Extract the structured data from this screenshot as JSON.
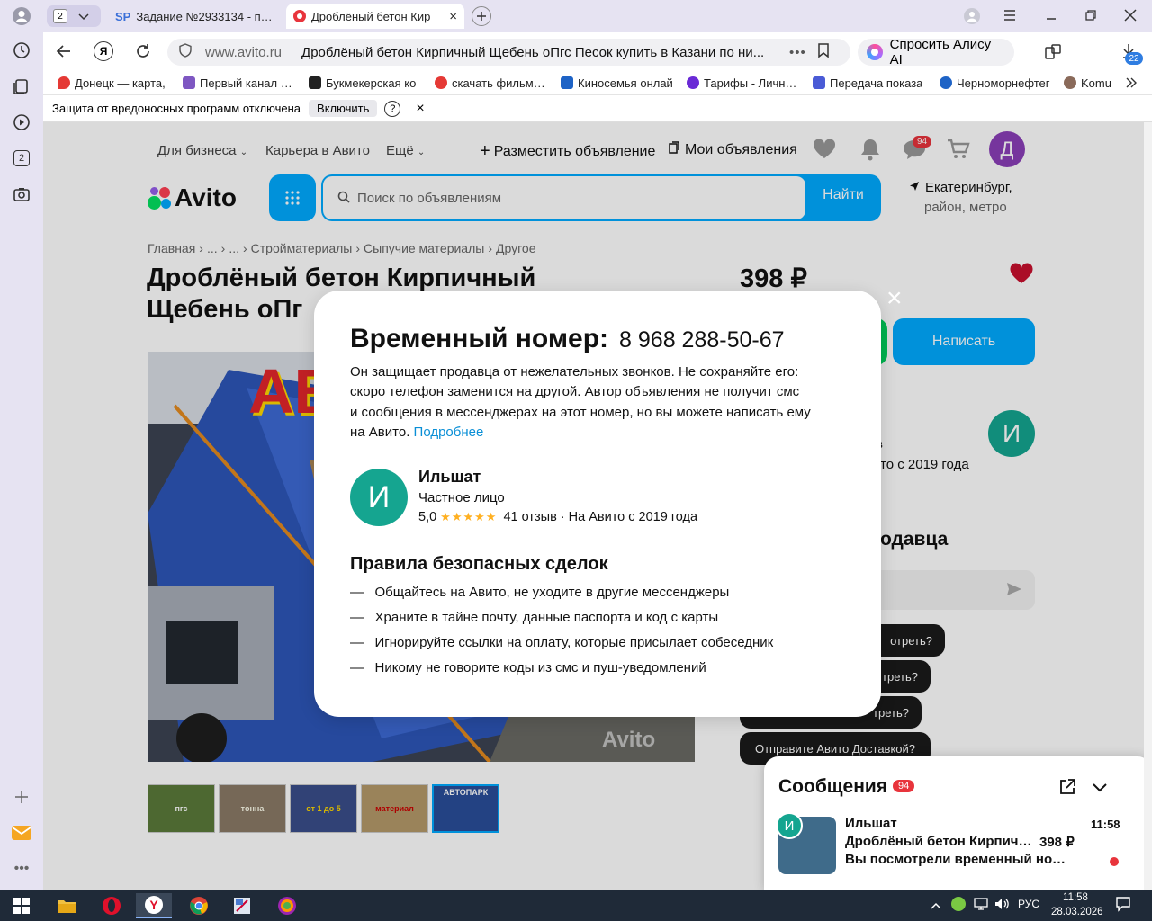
{
  "browser": {
    "tab_counter": "2",
    "tabs": [
      {
        "label": "Задание №2933134 - про",
        "favicon_text": "SP"
      },
      {
        "label": "Дроблёный бетон Кир",
        "active": true
      }
    ],
    "address": {
      "domain": "www.avito.ru",
      "title": "Дроблёный бетон Кирпичный Щебень оПгс Песок купить в Казани по ни..."
    },
    "alice_label": "Спросить Алису AI",
    "downloads_badge": "22",
    "bookmarks": [
      {
        "label": "Донецк — карта, ",
        "color": "#e53935"
      },
      {
        "label": "Первый канал — c",
        "color": "#7e57c2"
      },
      {
        "label": "Букмекерская ко",
        "color": "#222222"
      },
      {
        "label": "скачать фильмы 2",
        "color": "#e53935"
      },
      {
        "label": "Киносемья онлай",
        "color": "#1e63c6"
      },
      {
        "label": "Тарифы - Личный",
        "color": "#6a2ad6"
      },
      {
        "label": "Передача показа",
        "color": "#4a5bd6"
      },
      {
        "label": "Черноморнефтег",
        "color": "#1e63c6"
      },
      {
        "label": "Komu",
        "color": "#8a6a5a"
      }
    ],
    "infobar": {
      "text": "Защита от вредоносных программ отключена",
      "button": "Включить",
      "help": "?",
      "close": "×"
    }
  },
  "avito": {
    "nav": {
      "for_business": "Для бизнеса",
      "career": "Карьера в Авито",
      "more": "Ещё",
      "post_ad": "Разместить объявление",
      "my_ads": "Мои объявления",
      "messages_badge": "94",
      "avatar_letter": "Д"
    },
    "logo_text": "Avito",
    "search": {
      "placeholder": "Поиск по объявлениям",
      "button": "Найти"
    },
    "location": {
      "city": "Екатеринбург,",
      "sub": "район, метро"
    },
    "breadcrumbs": [
      "Главная",
      "...",
      "...",
      "Стройматериалы",
      "Сыпучие материалы",
      "Другое"
    ],
    "title_line1": "Дроблёный бетон Кирпичный",
    "title_line2": "Щебень оПг",
    "price": "398 ₽",
    "write_button": "Написать",
    "seller_since_partial": "то с 2019 года",
    "seller_partial_char": "в",
    "ask_heading_partial": "одавца",
    "quick_questions": [
      "отреть?",
      "треть?",
      "треть?",
      "Отправите Авито Доставкой?"
    ],
    "watermark": "Avito",
    "photo_banner": "АВ",
    "thumbnails": [
      {
        "label": "пгс",
        "color": "#5b7a3a"
      },
      {
        "label": "тонна",
        "color": "#8a7a66"
      },
      {
        "label": "от 1 до 5",
        "color": "#3a4e8a"
      },
      {
        "label": "материал",
        "color": "#b59a6a"
      },
      {
        "label": "АВТОПАРК",
        "color": "#2a4e9a"
      }
    ]
  },
  "modal": {
    "heading": "Временный номер:",
    "phone": "8 968 288-50-67",
    "description_lines": [
      "Он защищает продавца от нежелательных звонков. Не сохраняйте его:",
      "скоро телефон заменится на другой. Автор объявления не получит смс",
      "и сообщения в мессенджерах на этот номер, но вы можете написать ему"
    ],
    "description_last": "на Авито.",
    "more_link": "Подробнее",
    "seller": {
      "avatar_letter": "И",
      "name": "Ильшат",
      "type": "Частное лицо",
      "rating": "5,0",
      "stars": "★★★★★",
      "reviews": "41 отзыв · На Авито с 2019 года"
    },
    "rules_title": "Правила безопасных сделок",
    "rules": [
      "Общайтесь на Авито, не уходите в другие мессенджеры",
      "Храните в тайне почту, данные паспорта и код с карты",
      "Игнорируйте ссылки на оплату, которые присылает собеседник",
      "Никому не говорите коды из смс и пуш-уведомлений"
    ],
    "rule_dash": "—",
    "close": "×"
  },
  "messenger": {
    "title": "Сообщения",
    "badge": "94",
    "chat": {
      "avatar_letter": "И",
      "name": "Ильшат",
      "time": "11:58",
      "item": "Дроблёный бетон Кирпичн...",
      "price": "398 ₽",
      "preview": "Вы посмотрели временный ном..."
    }
  },
  "taskbar": {
    "lang": "РУС",
    "time": "11:58",
    "date": "28.03.2026"
  },
  "colors": {
    "avito_blue": "#00aaff",
    "avito_dark_blue": "#0a8fd6",
    "seller_avatar": "#15a590",
    "user_avatar": "#8a3fb8",
    "heart": "#c8102e",
    "badge_red": "#e8343c",
    "star": "#ffb021",
    "link": "#0a8fd6"
  }
}
